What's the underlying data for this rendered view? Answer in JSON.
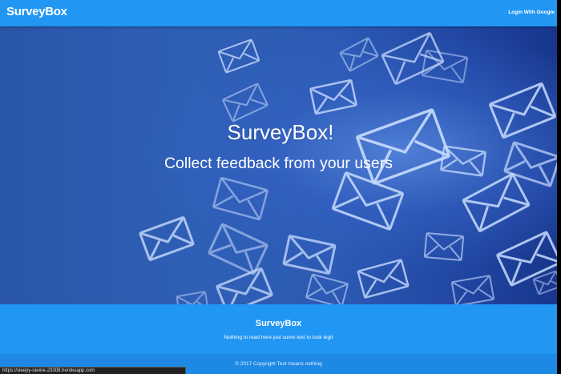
{
  "navbar": {
    "brand": "SurveyBox",
    "login_label": "Login With Google"
  },
  "hero": {
    "title": "SurveyBox!",
    "subtitle": "Collect feedback from your users",
    "background_icon": "envelope-icon"
  },
  "footer": {
    "title": "SurveyBox",
    "text": "Nothing to read here just some text to look legit",
    "copyright": "© 2017 Copyright Text means nothing"
  },
  "status_bar": {
    "url": "https://sleepy-ravine-23308.herokuapp.com"
  },
  "colors": {
    "primary": "#2196f3",
    "footer": "#1e88e5",
    "hero_dark": "#1f44a0"
  }
}
